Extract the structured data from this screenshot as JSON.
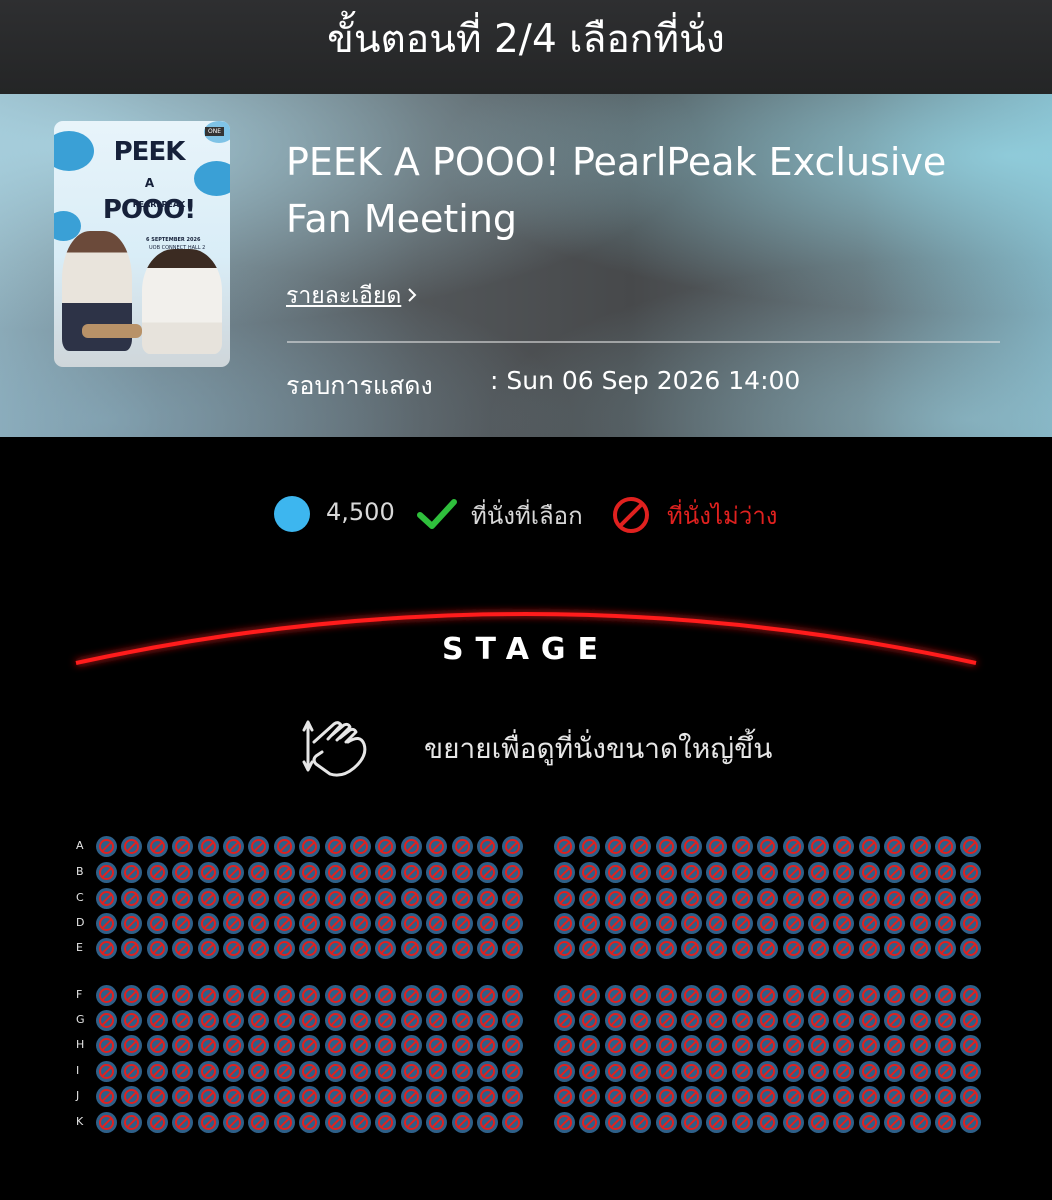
{
  "header": {
    "title": "ขั้นตอนที่ 2/4 เลือกที่นั่ง"
  },
  "event": {
    "poster": {
      "title_line1": "PEEK",
      "title_line2": "A",
      "title_line3": "POOO!",
      "subtitle": "PEARLPEAK",
      "date": "6 SEPTEMBER 2026",
      "venue": "UOB CONNECT HALL 2"
    },
    "title": "PEEK A POOO! PearlPeak Exclusive Fan Meeting",
    "detail_link": "รายละเอียด",
    "showtime_label": "รอบการแสดง",
    "showtime_value": ": Sun 06 Sep 2026 14:00"
  },
  "legend": {
    "price": "4,500",
    "selected_label": "ที่นั่งที่เลือก",
    "unavailable_label": "ที่นั่งไม่ว่าง",
    "colors": {
      "available": "#3db6ef",
      "selected": "#2fbf3c",
      "unavailable": "#e0211f"
    }
  },
  "stage": {
    "label": "STAGE",
    "arc_color": "#ff1a1a"
  },
  "zoom_hint": "ขยายเพื่อดูที่นั่งขนาดใหญ่ขึ้น",
  "seatmap": {
    "rows": [
      "A",
      "B",
      "C",
      "D",
      "E",
      "F",
      "G",
      "H",
      "I",
      "J",
      "K"
    ],
    "seats_per_section_row": 17,
    "sections": [
      "left",
      "right"
    ],
    "status": "unavailable"
  }
}
